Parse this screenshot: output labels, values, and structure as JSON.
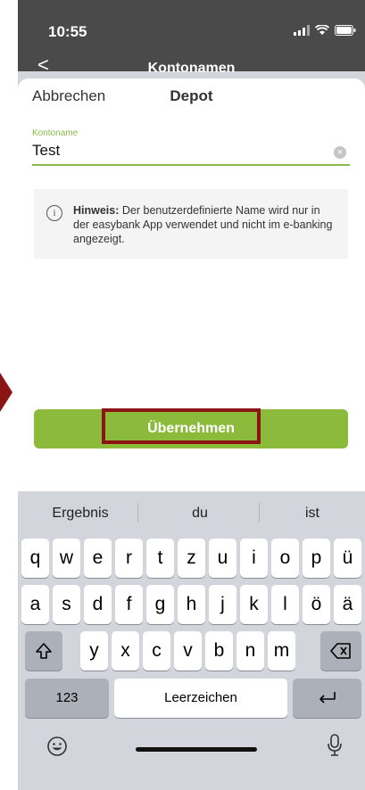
{
  "status": {
    "time": "10:55"
  },
  "nav": {
    "back_icon": "<",
    "title": "Kontonamen"
  },
  "sheet": {
    "cancel": "Abbrechen",
    "title": "Depot"
  },
  "field": {
    "label": "Kontoname",
    "value": "Test"
  },
  "hint": {
    "bold": "Hinweis:",
    "text": "Der benutzerdefinierte Name wird nur in der easybank App verwendet und nicht im e-banking angezeigt."
  },
  "apply": {
    "label": "Übernehmen"
  },
  "keyboard": {
    "suggestions": [
      "Ergebnis",
      "du",
      "ist"
    ],
    "row1": [
      "q",
      "w",
      "e",
      "r",
      "t",
      "z",
      "u",
      "i",
      "o",
      "p",
      "ü"
    ],
    "row2": [
      "a",
      "s",
      "d",
      "f",
      "g",
      "h",
      "j",
      "k",
      "l",
      "ö",
      "ä"
    ],
    "row3": [
      "y",
      "x",
      "c",
      "v",
      "b",
      "n",
      "m"
    ],
    "numbers_key": "123",
    "space_key": "Leerzeichen",
    "return_icon": "return-arrow-icon",
    "shift_icon": "shift-icon",
    "delete_icon": "delete-icon",
    "emoji_icon": "emoji-icon",
    "mic_icon": "microphone-icon"
  },
  "colors": {
    "accent": "#8cbb3c",
    "highlight": "#8b1414"
  }
}
